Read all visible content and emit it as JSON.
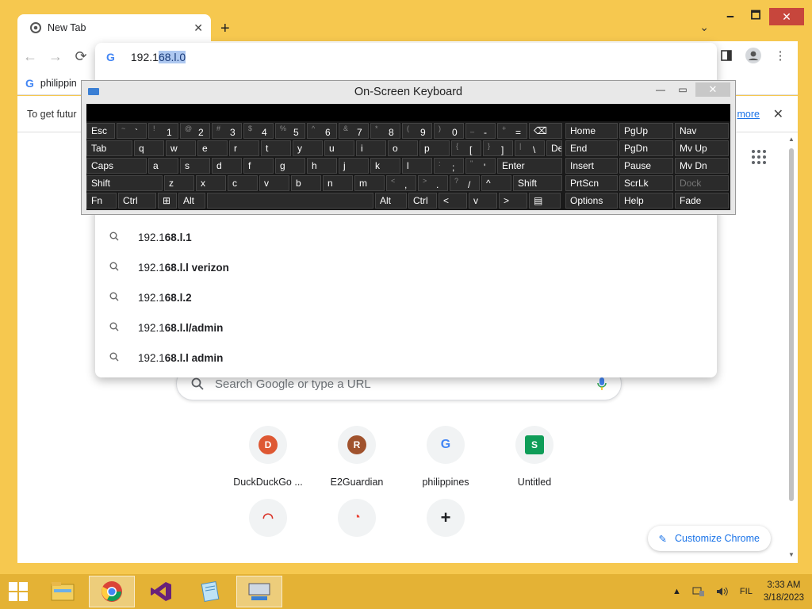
{
  "window": {
    "minimize": "🗕",
    "maximize": "🗖",
    "close": "✕"
  },
  "tab": {
    "title": "New Tab",
    "close": "✕",
    "new_tab": "+"
  },
  "toolbar": {
    "back": "←",
    "forward": "→",
    "reload": "⟳"
  },
  "omnibox": {
    "text_plain": "192.1",
    "text_selected": "68.l.0",
    "suggestions": [
      {
        "prefix": "192.1",
        "bold": "68.l.1"
      },
      {
        "prefix": "192.1",
        "bold": "68.l.l verizon"
      },
      {
        "prefix": "192.1",
        "bold": "68.l.2"
      },
      {
        "prefix": "192.1",
        "bold": "68.l.l/admin"
      },
      {
        "prefix": "192.1",
        "bold": "68.l.l admin"
      }
    ]
  },
  "bookmarks": {
    "item": "philippin"
  },
  "infobar": {
    "text": "To get futur",
    "link": "more",
    "close": "✕"
  },
  "ntp": {
    "search_placeholder": "Search Google or type a URL",
    "tiles": [
      {
        "label": "DuckDuckGo ...",
        "icon": "duckduckgo-icon",
        "glyph": "D",
        "color": "#de5833"
      },
      {
        "label": "E2Guardian",
        "icon": "e2guardian-icon",
        "glyph": "R",
        "color": "#a0522d"
      },
      {
        "label": "philippines",
        "icon": "google-icon",
        "glyph": "G",
        "color": "#4285f4"
      },
      {
        "label": "Untitled",
        "icon": "sheets-icon",
        "glyph": "S",
        "color": "#0f9d58"
      },
      {
        "label": "",
        "icon": "speedometer-icon",
        "glyph": "◠",
        "color": "#d93025"
      },
      {
        "label": "",
        "icon": "chrome-webstore-icon",
        "glyph": "◔",
        "color": "#ea4335"
      },
      {
        "label": "",
        "icon": "add-shortcut-icon",
        "glyph": "+",
        "color": "#202124"
      }
    ],
    "customize": "Customize Chrome"
  },
  "osk": {
    "title": "On-Screen Keyboard",
    "minimize": "—",
    "maximize": "▭",
    "close": "✕",
    "rows": [
      [
        {
          "m": "Esc"
        },
        {
          "s": "~",
          "m": "`"
        },
        {
          "s": "!",
          "m": "1"
        },
        {
          "s": "@",
          "m": "2"
        },
        {
          "s": "#",
          "m": "3"
        },
        {
          "s": "$",
          "m": "4"
        },
        {
          "s": "%",
          "m": "5"
        },
        {
          "s": "^",
          "m": "6"
        },
        {
          "s": "&",
          "m": "7"
        },
        {
          "s": "*",
          "m": "8"
        },
        {
          "s": "(",
          "m": "9"
        },
        {
          "s": ")",
          "m": "0"
        },
        {
          "s": "_",
          "m": "-"
        },
        {
          "s": "+",
          "m": "="
        },
        {
          "m": "⌫"
        }
      ],
      [
        {
          "m": "Tab"
        },
        {
          "m": "q"
        },
        {
          "m": "w"
        },
        {
          "m": "e"
        },
        {
          "m": "r"
        },
        {
          "m": "t"
        },
        {
          "m": "y"
        },
        {
          "m": "u"
        },
        {
          "m": "i"
        },
        {
          "m": "o"
        },
        {
          "m": "p"
        },
        {
          "s": "{",
          "m": "["
        },
        {
          "s": "}",
          "m": "]"
        },
        {
          "s": "|",
          "m": "\\"
        },
        {
          "m": "Del"
        }
      ],
      [
        {
          "m": "Caps"
        },
        {
          "m": "a"
        },
        {
          "m": "s"
        },
        {
          "m": "d"
        },
        {
          "m": "f"
        },
        {
          "m": "g"
        },
        {
          "m": "h"
        },
        {
          "m": "j"
        },
        {
          "m": "k"
        },
        {
          "m": "l"
        },
        {
          "s": ":",
          "m": ";"
        },
        {
          "s": "\"",
          "m": "'"
        },
        {
          "m": "Enter"
        }
      ],
      [
        {
          "m": "Shift"
        },
        {
          "m": "z"
        },
        {
          "m": "x"
        },
        {
          "m": "c"
        },
        {
          "m": "v"
        },
        {
          "m": "b"
        },
        {
          "m": "n"
        },
        {
          "m": "m"
        },
        {
          "s": "<",
          "m": ","
        },
        {
          "s": ">",
          "m": "."
        },
        {
          "s": "?",
          "m": "/"
        },
        {
          "m": "^"
        },
        {
          "m": "Shift"
        }
      ],
      [
        {
          "m": "Fn"
        },
        {
          "m": "Ctrl"
        },
        {
          "m": "⊞"
        },
        {
          "m": "Alt"
        },
        {
          "m": ""
        },
        {
          "m": "Alt"
        },
        {
          "m": "Ctrl"
        },
        {
          "m": "<"
        },
        {
          "m": "v"
        },
        {
          "m": ">"
        },
        {
          "m": "▤"
        }
      ]
    ],
    "nav_keys": [
      [
        "Home",
        "PgUp",
        "Nav"
      ],
      [
        "End",
        "PgDn",
        "Mv Up"
      ],
      [
        "Insert",
        "Pause",
        "Mv Dn"
      ],
      [
        "PrtScn",
        "ScrLk",
        "Dock"
      ],
      [
        "Options",
        "Help",
        "Fade"
      ]
    ]
  },
  "taskbar": {
    "items": [
      "file-explorer-icon",
      "chrome-icon",
      "visual-studio-icon",
      "notepad-icon",
      "on-screen-keyboard-icon"
    ],
    "tray_up": "▲",
    "language": "FIL",
    "time": "3:33 AM",
    "date": "3/18/2023"
  }
}
